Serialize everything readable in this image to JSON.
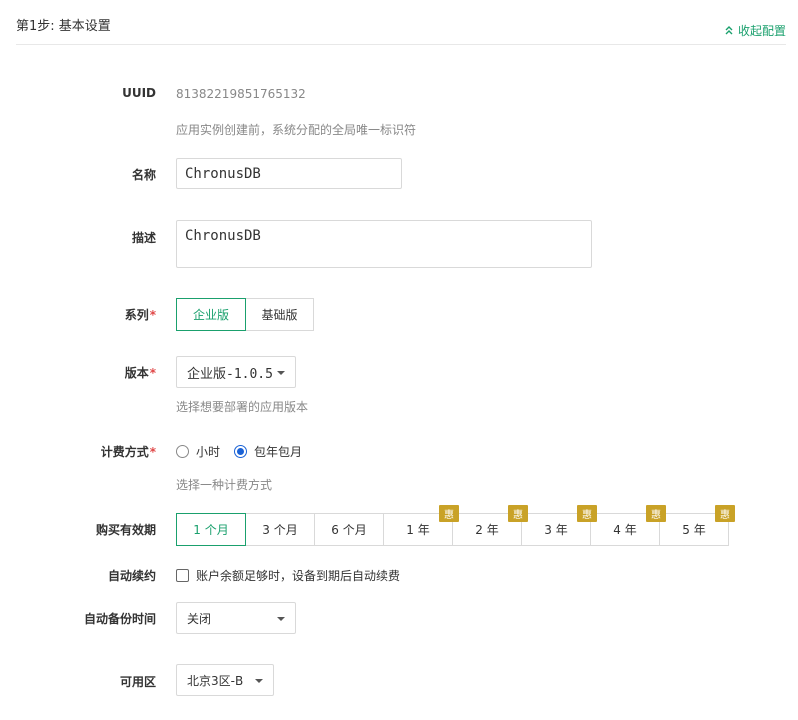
{
  "header": {
    "step_title": "第1步: 基本设置",
    "collapse_label": "收起配置"
  },
  "form": {
    "uuid": {
      "label": "UUID",
      "value": "81382219851765132",
      "hint": "应用实例创建前，系统分配的全局唯一标识符"
    },
    "name": {
      "label": "名称",
      "value": "ChronusDB"
    },
    "description": {
      "label": "描述",
      "value": "ChronusDB"
    },
    "series": {
      "label": "系列",
      "required": "*",
      "options": [
        "企业版",
        "基础版"
      ],
      "selected": "企业版"
    },
    "version": {
      "label": "版本",
      "required": "*",
      "selected": "企业版-1.0.5",
      "hint": "选择想要部署的应用版本"
    },
    "billing": {
      "label": "计费方式",
      "required": "*",
      "options": [
        "小时",
        "包年包月"
      ],
      "selected": "包年包月",
      "hint": "选择一种计费方式"
    },
    "period": {
      "label": "购买有效期",
      "options": [
        {
          "label": "1 个月",
          "badge": ""
        },
        {
          "label": "3 个月",
          "badge": ""
        },
        {
          "label": "6 个月",
          "badge": ""
        },
        {
          "label": "1 年",
          "badge": "惠"
        },
        {
          "label": "2 年",
          "badge": "惠"
        },
        {
          "label": "3 年",
          "badge": "惠"
        },
        {
          "label": "4 年",
          "badge": "惠"
        },
        {
          "label": "5 年",
          "badge": "惠"
        }
      ],
      "selected": "1 个月"
    },
    "auto_renew": {
      "label": "自动续约",
      "checkbox_text": "账户余额足够时，设备到期后自动续费",
      "checked": false
    },
    "backup_time": {
      "label": "自动备份时间",
      "selected": "关闭"
    },
    "zone": {
      "label": "可用区",
      "selected": "北京3区-B"
    }
  },
  "colors": {
    "accent": "#1aa06d",
    "radio": "#1a62d6",
    "required": "#e04848",
    "badge": "#c9a227"
  }
}
